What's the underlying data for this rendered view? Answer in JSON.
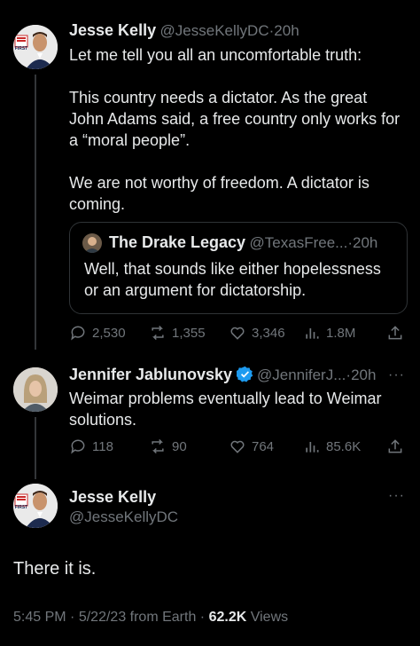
{
  "thread": [
    {
      "name": "Jesse Kelly",
      "handle": "@JesseKellyDC",
      "dot": "·",
      "time": "20h",
      "avatar_badge": "FIRST",
      "text_lines": [
        "Let me tell you all an uncomfortable truth:",
        "",
        "This country needs a dictator. As the great",
        "John Adams said, a free country only works for",
        "a “moral people”.",
        "",
        "We are not worthy of freedom. A dictator is",
        "coming."
      ],
      "quote": {
        "name": "The Drake Legacy",
        "handle": "@TexasFree...",
        "dot": "·",
        "time": "20h",
        "text_lines": [
          "Well, that sounds like either hopelessness",
          "or an argument for dictatorship."
        ]
      },
      "stats": {
        "replies": "2,530",
        "reposts": "1,355",
        "likes": "3,346",
        "views": "1.8M"
      }
    },
    {
      "name": "Jennifer Jablunovsky",
      "handle": "@JenniferJ...",
      "dot": "·",
      "time": "20h",
      "more": "···",
      "text_lines": [
        "Weimar problems eventually lead to Weimar",
        "solutions."
      ],
      "stats": {
        "replies": "118",
        "reposts": "90",
        "likes": "764",
        "views": "85.6K"
      }
    }
  ],
  "main": {
    "name": "Jesse Kelly",
    "handle": "@JesseKellyDC",
    "more": "···",
    "avatar_badge": "FIRST",
    "text": "There it is.",
    "meta": {
      "time": "5:45 PM",
      "dot1": "·",
      "date": "5/22/23 from Earth",
      "dot2": "·",
      "views_count": "62.2K",
      "views_label": "Views"
    }
  },
  "colors": {
    "background": "#000000",
    "text": "#e7e9ea",
    "muted": "#71767b",
    "verified": "#1d9bf0",
    "border": "#2f3336"
  }
}
